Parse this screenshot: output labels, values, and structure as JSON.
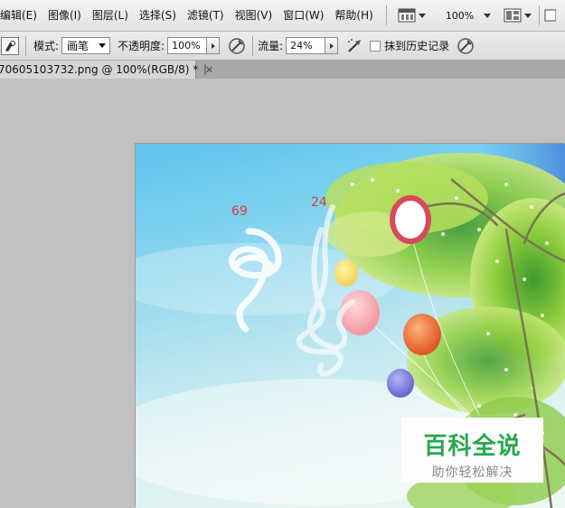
{
  "menu": {
    "items": [
      "编辑(E)",
      "图像(I)",
      "图层(L)",
      "选择(S)",
      "滤镜(T)",
      "视图(V)",
      "窗口(W)",
      "帮助(H)"
    ],
    "zoom": "100%"
  },
  "options": {
    "mode_label": "模式:",
    "mode_value": "画笔",
    "opacity_label": "不透明度:",
    "opacity_value": "100%",
    "flow_label": "流量:",
    "flow_value": "24%",
    "erase_history_label": "抹到历史记录"
  },
  "document": {
    "tab_title": "70605103732.png @ 100%(RGB/8) *"
  },
  "canvas": {
    "annotation_1": "69",
    "annotation_2": "24"
  },
  "watermark": {
    "main": "百科全说",
    "sub": "助你轻松解决"
  },
  "colors": {
    "watermark_green": "#27a84e",
    "annotation_red": "#d24040"
  }
}
